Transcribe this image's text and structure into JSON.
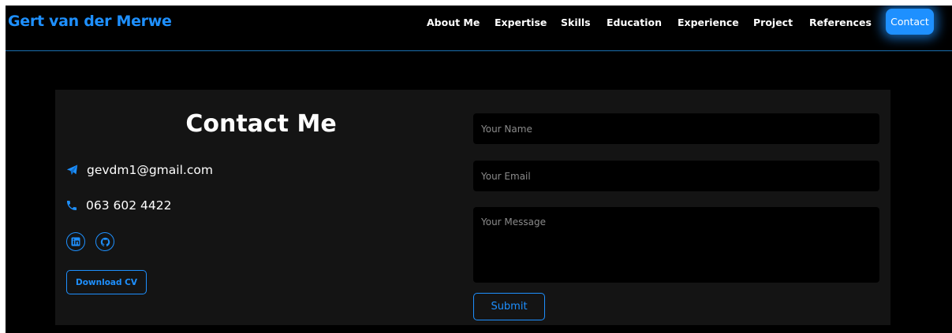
{
  "nav": {
    "brand": "Gert van der Merwe",
    "items": [
      {
        "label": "About Me"
      },
      {
        "label": "Expertise"
      },
      {
        "label": "Skills"
      },
      {
        "label": "Education"
      },
      {
        "label": "Experience"
      },
      {
        "label": "Project"
      },
      {
        "label": "References"
      }
    ],
    "contact_label": "Contact"
  },
  "contact": {
    "title": "Contact Me",
    "email": "gevdm1@gmail.com",
    "phone": "063 602 4422",
    "socials": [
      {
        "icon": "linkedin-icon"
      },
      {
        "icon": "github-icon"
      }
    ],
    "download_label": "Download CV"
  },
  "form": {
    "name_placeholder": "Your Name",
    "email_placeholder": "Your Email",
    "message_placeholder": "Your Message",
    "submit_label": "Submit"
  },
  "colors": {
    "accent": "#1e90ff",
    "background": "#000000",
    "panel": "#141414"
  }
}
